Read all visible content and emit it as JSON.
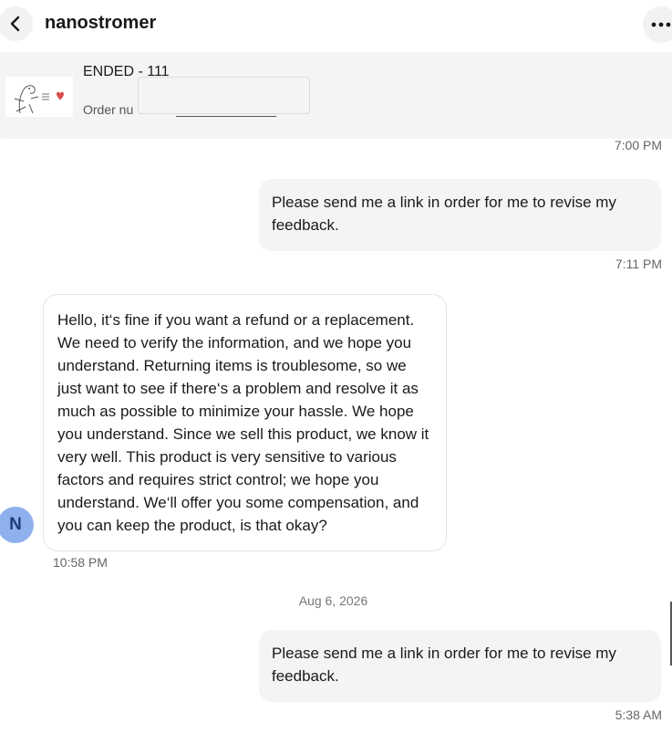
{
  "header": {
    "title": "nanostromer",
    "back_icon": "chevron-left-icon",
    "more_icon": "more-horizontal-icon"
  },
  "order": {
    "status": "ENDED - 111",
    "number_label": "Order nu"
  },
  "messages": [
    {
      "partial_time": "7:00 PM"
    },
    {
      "text": "Please send me a link in order for me to revise my feedback.",
      "time": "7:11 PM"
    },
    {
      "avatar": "N",
      "text": "Hello, it‘s fine if you want a refund or a replacement. We need to verify the information, and we hope you understand. Returning items is troublesome, so we just want to see if there‘s a problem and resolve it as much as possible to minimize your hassle. We hope you understand. Since we sell this product, we know it very well. This product is very sensitive to various factors and requires strict control; we hope you understand. We‘ll offer you some compensation, and you can keep the product, is that okay?",
      "time": "10:58 PM"
    },
    {
      "date_separator": "Aug 6, 2026"
    },
    {
      "text": "Please send me a link in order for me to revise my feedback.",
      "time": "5:38 AM"
    }
  ],
  "colors": {
    "bubble_outgoing": "#f4f4f4",
    "avatar_bg": "#8fb0ee",
    "avatar_text": "#1e3b7a"
  }
}
